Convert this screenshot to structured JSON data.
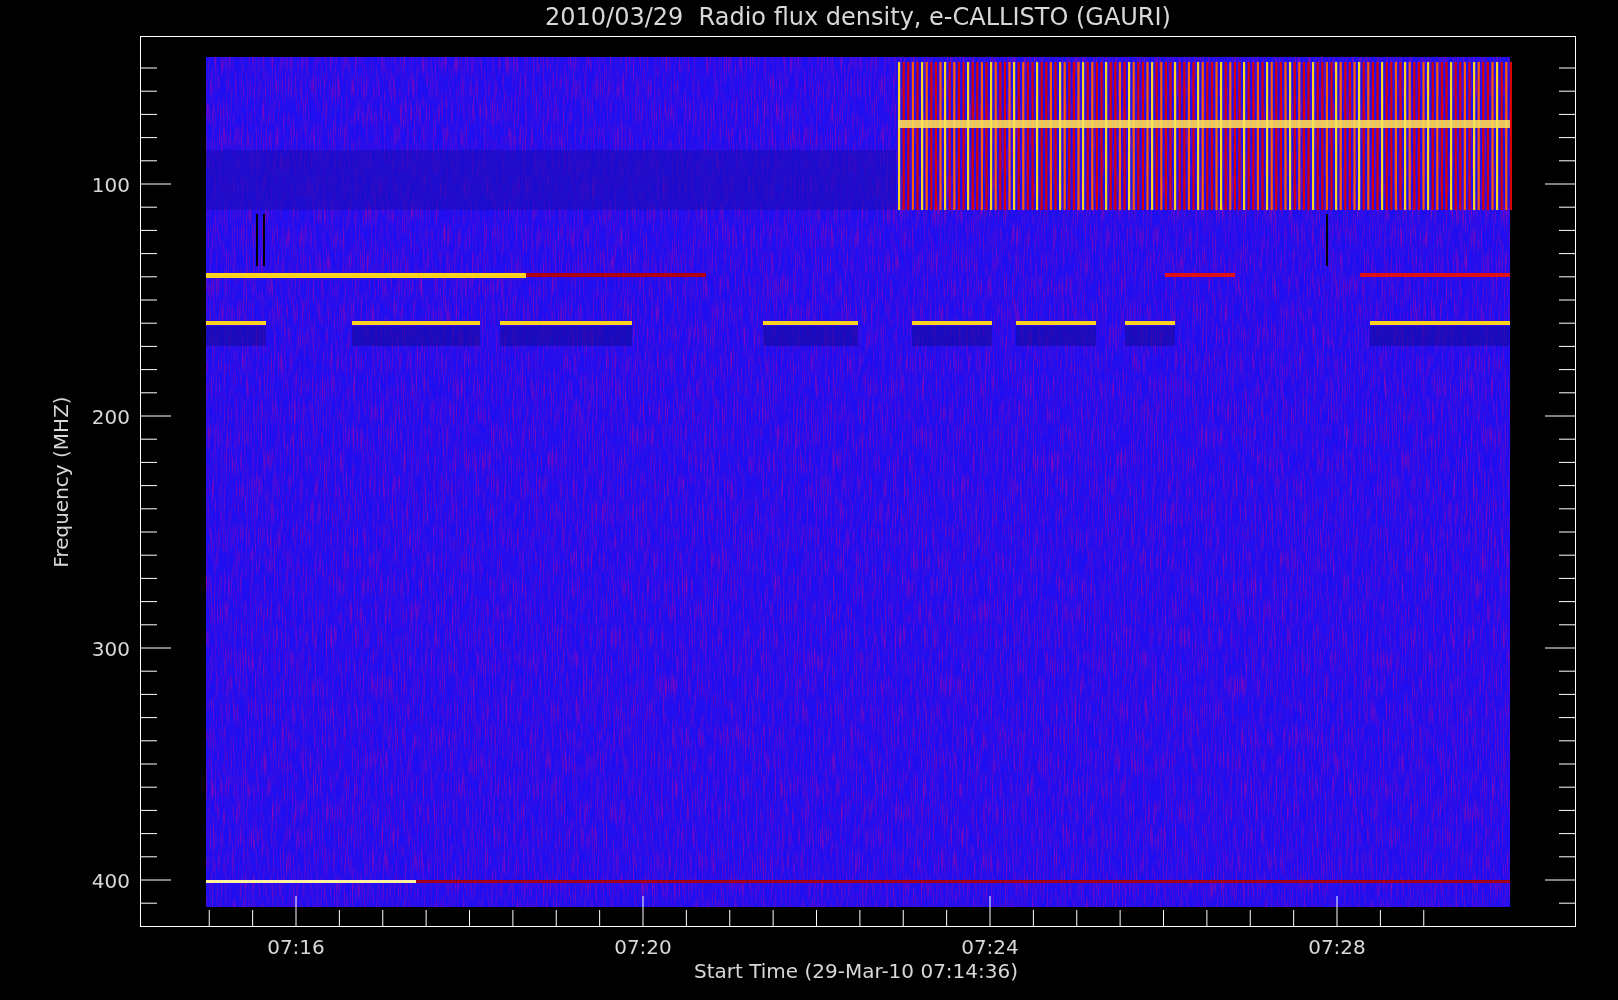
{
  "title": "2010/03/29  Radio flux density, e-CALLISTO (GAURI)",
  "y_axis": {
    "label": "Frequency (MHZ)",
    "ticks": [
      "100",
      "200",
      "300",
      "400"
    ]
  },
  "x_axis": {
    "label": "Start Time (29-Mar-10 07:14:36)",
    "ticks": [
      "07:16",
      "07:20",
      "07:24",
      "07:28"
    ]
  }
}
